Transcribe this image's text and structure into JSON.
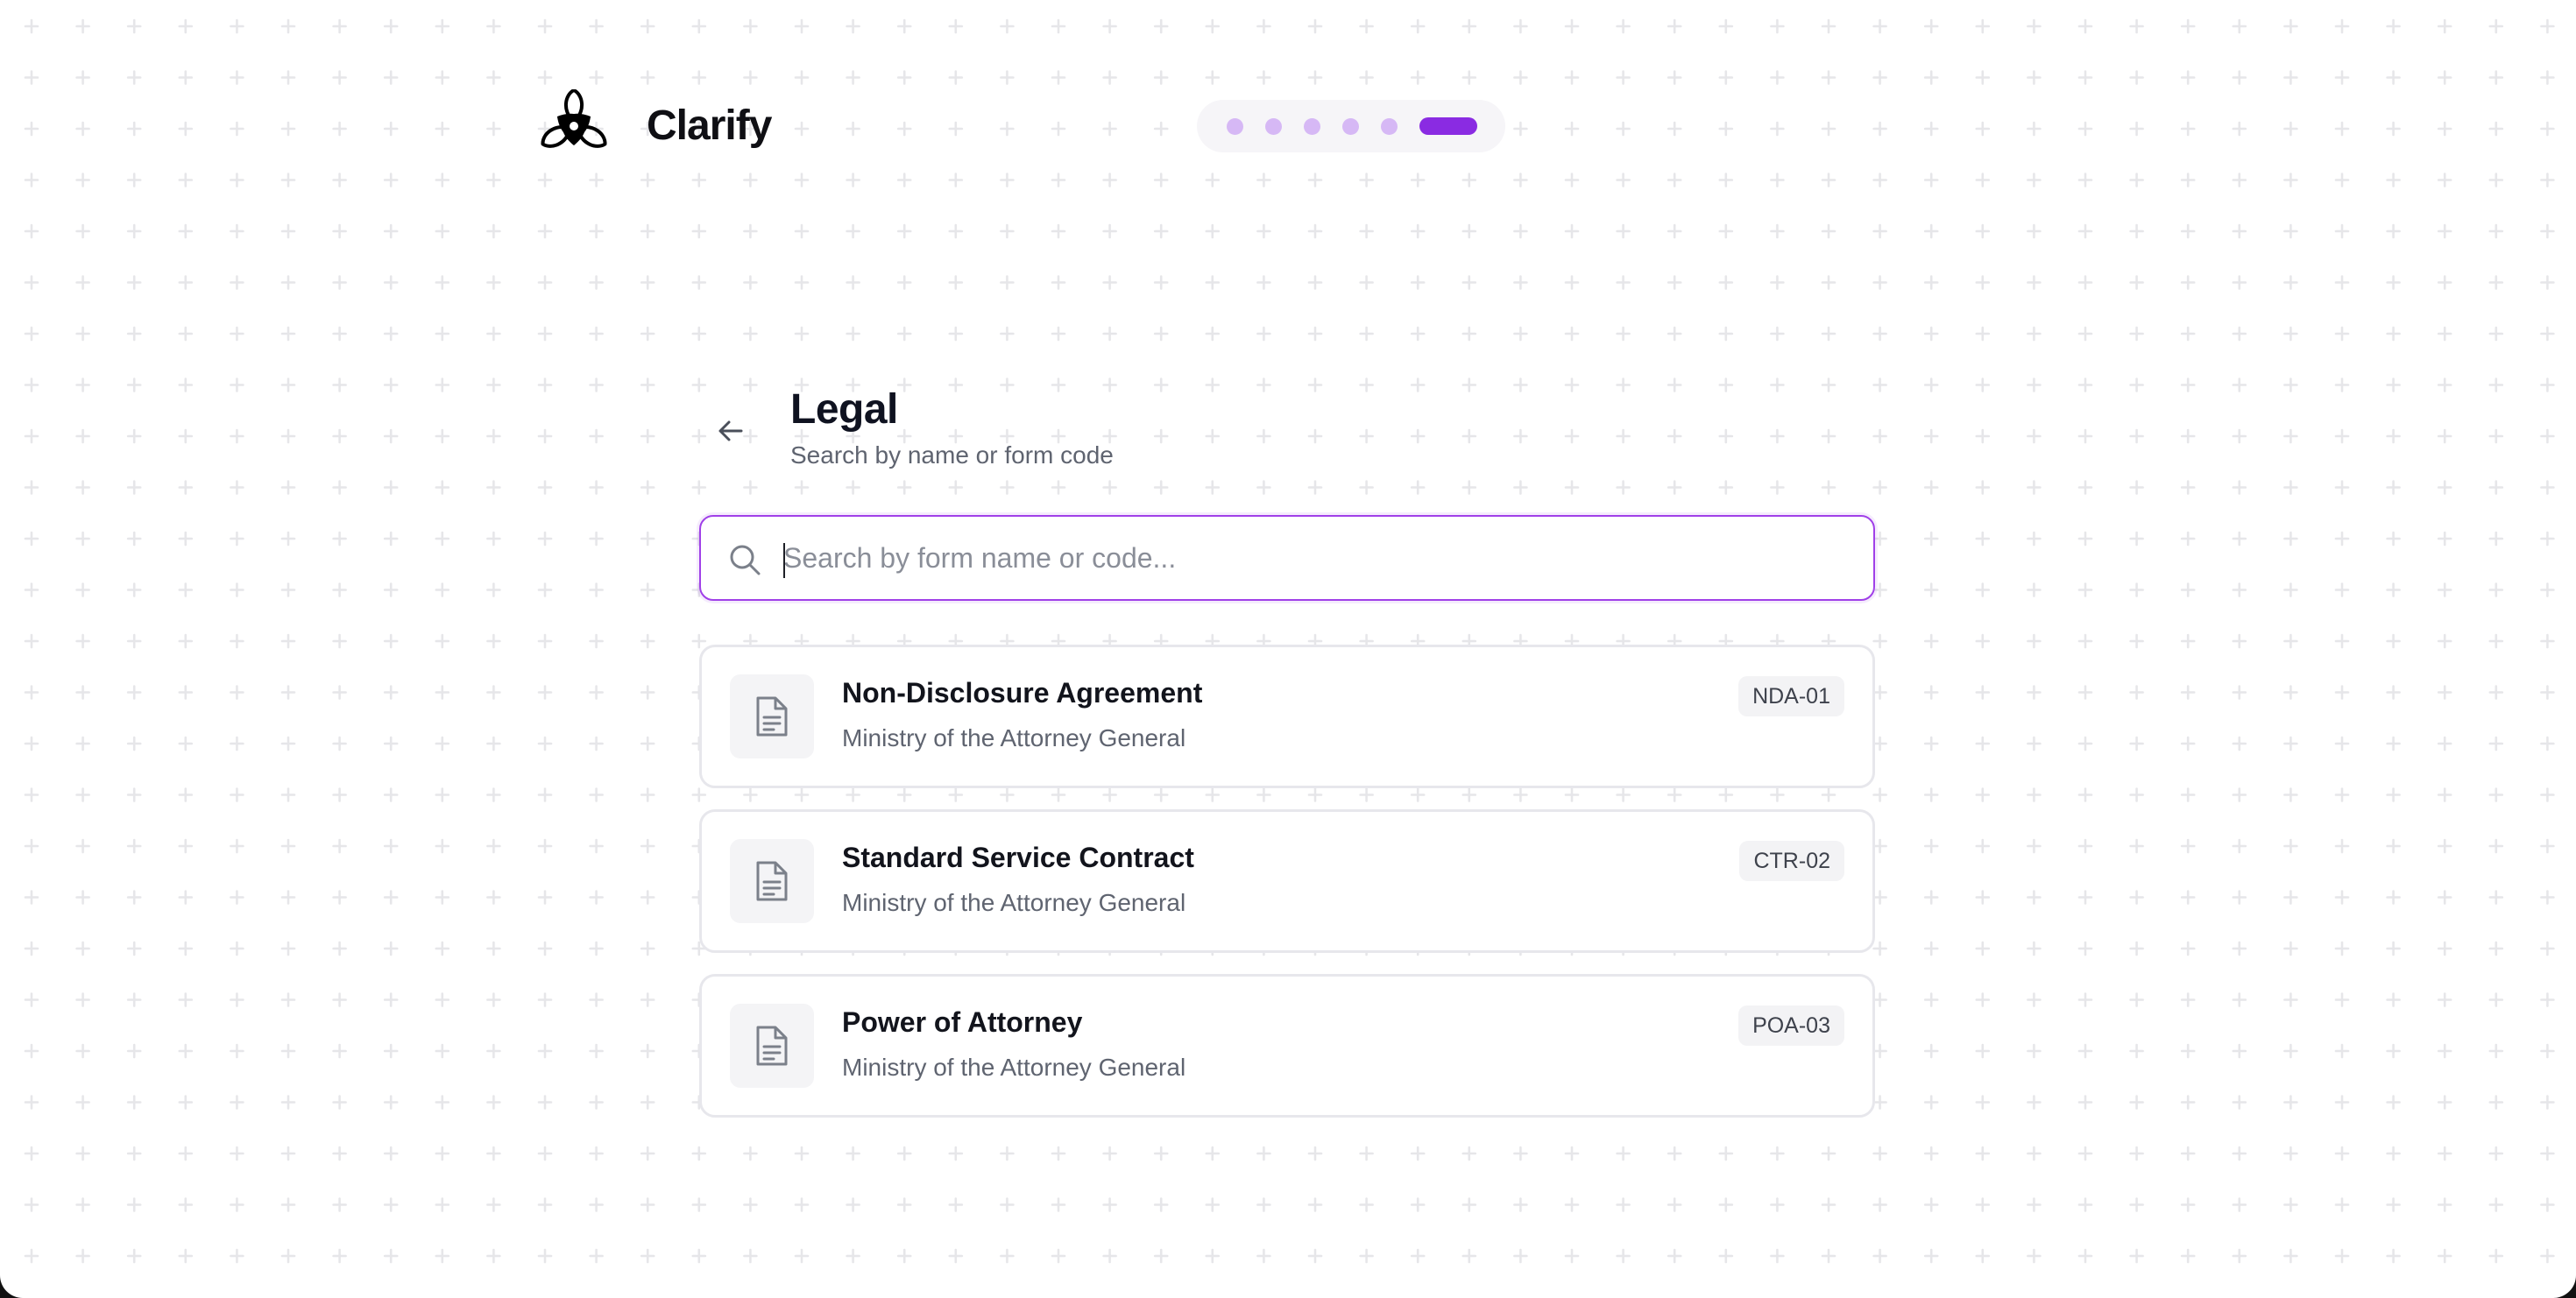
{
  "header": {
    "brand_name": "Clarify",
    "progress": {
      "total_steps": 6,
      "current_step": 6
    }
  },
  "page": {
    "title": "Legal",
    "subtitle": "Search by name or form code"
  },
  "search": {
    "placeholder": "Search by form name or code...",
    "value": ""
  },
  "forms": [
    {
      "title": "Non-Disclosure Agreement",
      "ministry": "Ministry of the Attorney General",
      "code": "NDA-01"
    },
    {
      "title": "Standard Service Contract",
      "ministry": "Ministry of the Attorney General",
      "code": "CTR-02"
    },
    {
      "title": "Power of Attorney",
      "ministry": "Ministry of the Attorney General",
      "code": "POA-03"
    }
  ],
  "colors": {
    "accent": "#8a2be2",
    "accent_light": "#d6b8f5",
    "focus_border": "#a040e8"
  },
  "icons": {
    "logo": "flower-logo-icon",
    "back": "arrow-left-icon",
    "search": "search-icon",
    "form": "document-icon"
  }
}
